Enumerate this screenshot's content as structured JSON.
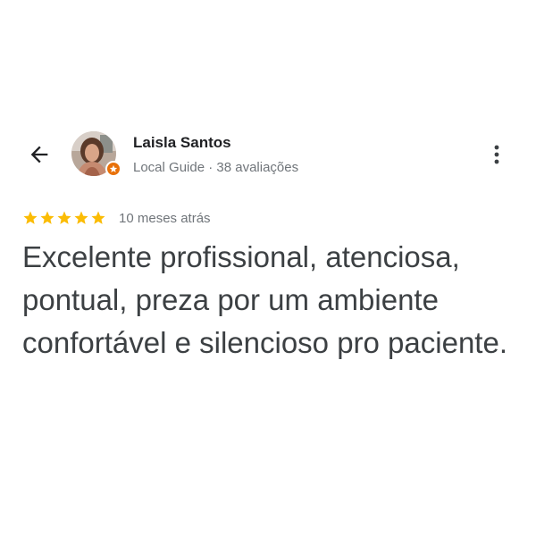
{
  "reviewer": {
    "name": "Laisla Santos",
    "meta": "Local Guide · 38 avaliações",
    "avatar_icon": "profile-photo",
    "badge_icon": "local-guide-star-icon"
  },
  "review": {
    "rating": 5,
    "rating_max": 5,
    "date": "10 meses atrás",
    "text": "Excelente profissional, atenciosa, pontual, preza por um ambiente confortável e silencioso pro paciente."
  },
  "icons": {
    "back": "arrow-left-icon",
    "more": "more-vert-icon",
    "star": "star-icon"
  },
  "colors": {
    "star": "#fbbc04",
    "badge": "#e8710a",
    "text": "#3c4043",
    "secondary_text": "#70757a",
    "name": "#202124"
  }
}
